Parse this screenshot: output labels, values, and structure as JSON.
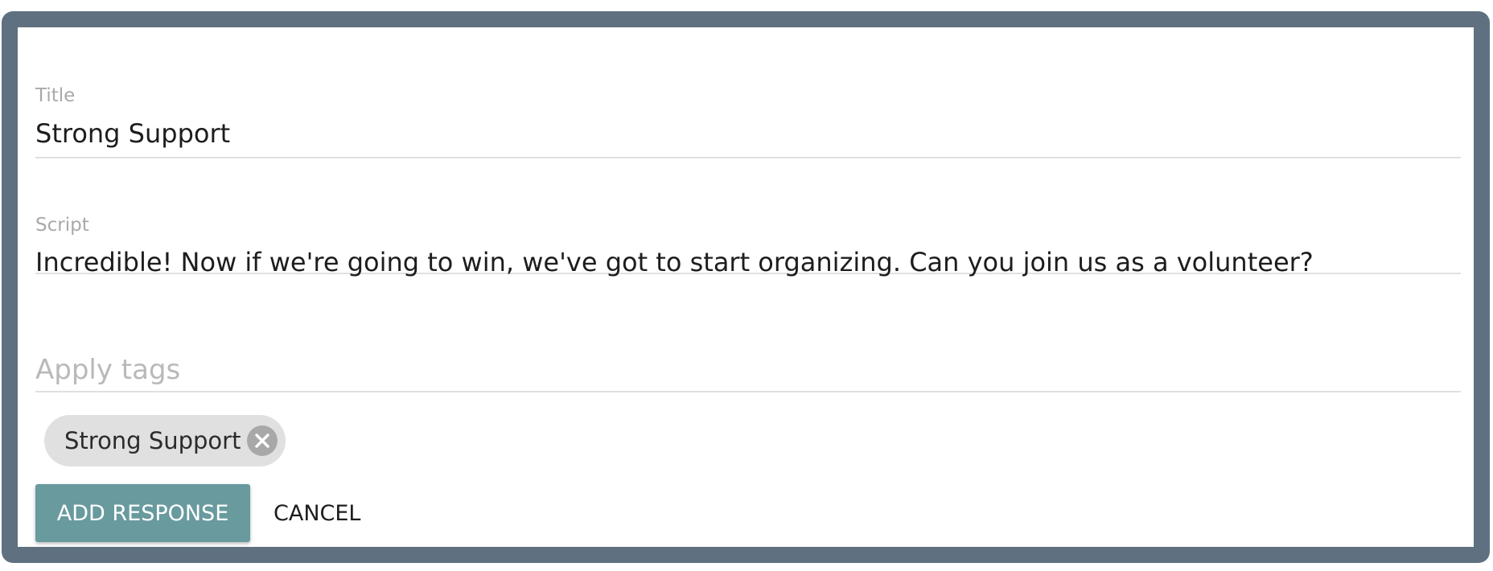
{
  "form": {
    "title_label": "Title",
    "title_value": "Strong Support",
    "script_label": "Script",
    "script_value": "Incredible! Now if we're going to win, we've got to start organizing. Can you join us as a volunteer?",
    "tags_placeholder": "Apply tags",
    "tags": [
      {
        "label": "Strong Support",
        "remove_icon": "cancel-circle-icon"
      }
    ]
  },
  "actions": {
    "submit_label": "ADD RESPONSE",
    "cancel_label": "CANCEL"
  },
  "colors": {
    "frame": "#5f7180",
    "primary_button": "#689a9e",
    "chip_background": "#e0e0e0",
    "chip_close": "#a8a8a8",
    "label_text": "#a9a9a9",
    "divider": "#e0e0e0"
  }
}
